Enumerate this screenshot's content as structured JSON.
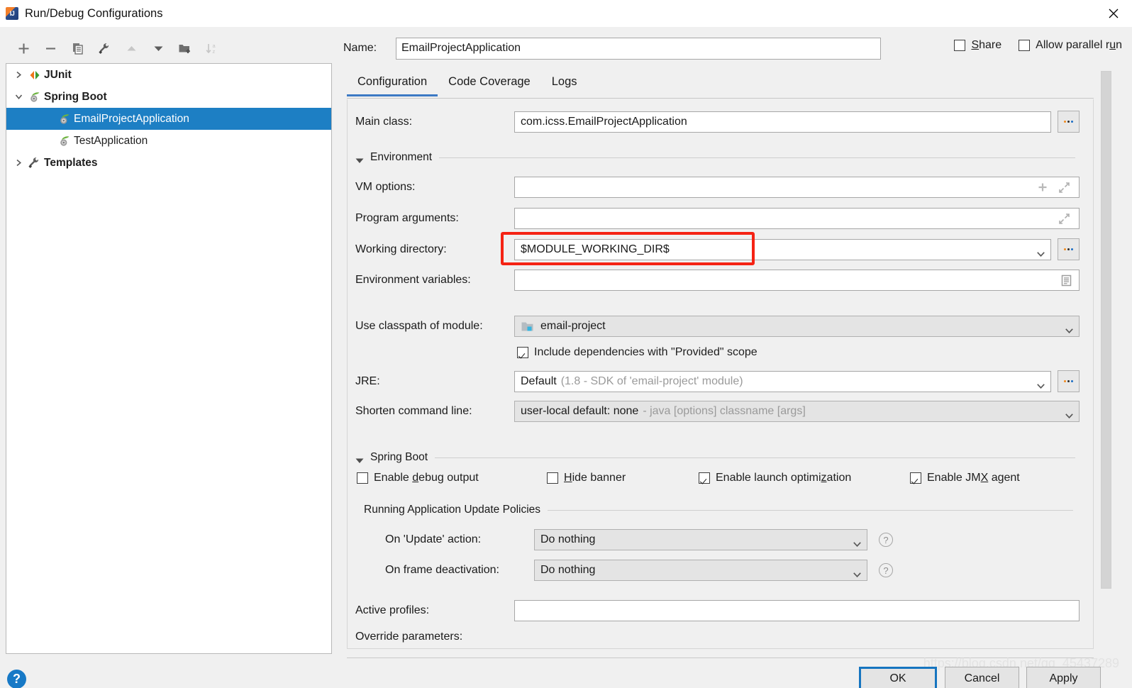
{
  "window": {
    "title": "Run/Debug Configurations",
    "app_icon": "intellij-idea-icon",
    "close_icon": "close-icon"
  },
  "left_toolbar": {
    "buttons": [
      {
        "name": "add-configuration-button",
        "icon": "plus-icon",
        "enabled": true
      },
      {
        "name": "remove-configuration-button",
        "icon": "minus-icon",
        "enabled": true
      },
      {
        "name": "copy-configuration-button",
        "icon": "copy-icon",
        "enabled": true
      },
      {
        "name": "edit-templates-button",
        "icon": "wrench-icon",
        "enabled": true
      },
      {
        "name": "move-up-button",
        "icon": "arrow-up-icon",
        "enabled": false
      },
      {
        "name": "move-down-button",
        "icon": "arrow-down-icon",
        "enabled": true
      },
      {
        "name": "new-folder-button",
        "icon": "folder-add-icon",
        "enabled": true
      },
      {
        "name": "sort-configurations-button",
        "icon": "sort-alphabetical-icon",
        "enabled": false
      }
    ]
  },
  "tree": {
    "items": [
      {
        "label": "JUnit",
        "icon": "junit-icon",
        "level": 0,
        "expanded": false,
        "has_toggle": true,
        "selected": false
      },
      {
        "label": "Spring Boot",
        "icon": "spring-boot-icon",
        "level": 0,
        "expanded": true,
        "has_toggle": true,
        "selected": false
      },
      {
        "label": "EmailProjectApplication",
        "icon": "spring-boot-icon",
        "level": 1,
        "has_toggle": false,
        "selected": true
      },
      {
        "label": "TestApplication",
        "icon": "spring-boot-icon",
        "level": 1,
        "has_toggle": false,
        "selected": false
      },
      {
        "label": "Templates",
        "icon": "wrench-icon",
        "level": 0,
        "expanded": false,
        "has_toggle": true,
        "selected": false
      }
    ]
  },
  "header": {
    "name_label": "Name:",
    "name_value": "EmailProjectApplication",
    "name_placeholder": "",
    "share": {
      "label": "Share",
      "mnemonic": "S",
      "checked": false
    },
    "allow_parallel_run": {
      "label": "Allow parallel run",
      "mnemonic": "u",
      "checked": false
    }
  },
  "tabs": [
    {
      "label": "Configuration",
      "active": true
    },
    {
      "label": "Code Coverage",
      "active": false
    },
    {
      "label": "Logs",
      "active": false
    }
  ],
  "configuration": {
    "main_class": {
      "label": "Main class:",
      "value": "com.icss.EmailProjectApplication",
      "browse_icon": "ellipsis-icon"
    },
    "environment_section": {
      "title": "Environment",
      "expanded": true,
      "toggle_icon": "triangle-down-icon"
    },
    "vm_options": {
      "label": "VM options:",
      "value": "",
      "placeholder": "",
      "icons": [
        "plus-icon",
        "expand-editor-icon"
      ]
    },
    "program_arguments": {
      "label": "Program arguments:",
      "value": "",
      "placeholder": "",
      "icons": [
        "expand-editor-icon"
      ]
    },
    "working_directory": {
      "label": "Working directory:",
      "value": "$MODULE_WORKING_DIR$",
      "placeholder": "",
      "dropdown_icon": "chevron-down-icon",
      "browse_icon": "ellipsis-icon",
      "highlighted": true,
      "highlight_color": "#f52314"
    },
    "environment_variables": {
      "label": "Environment variables:",
      "value": "",
      "placeholder": "",
      "icon": "list-edit-icon"
    },
    "use_classpath_of_module": {
      "label": "Use classpath of module:",
      "value": "email-project",
      "icon": "module-icon",
      "dropdown_icon": "chevron-down-icon"
    },
    "include_provided": {
      "label": "Include dependencies with \"Provided\" scope",
      "checked": true
    },
    "jre": {
      "label": "JRE:",
      "value": "Default",
      "value_hint": "(1.8 - SDK of 'email-project' module)",
      "dropdown_icon": "chevron-down-icon",
      "browse_icon": "ellipsis-icon"
    },
    "shorten_command_line": {
      "label": "Shorten command line:",
      "value": "user-local default: none",
      "value_hint": "- java [options] classname [args]",
      "dropdown_icon": "chevron-down-icon"
    },
    "spring_boot_section": {
      "title": "Spring Boot",
      "expanded": true,
      "toggle_icon": "triangle-down-icon"
    },
    "spring_boot_checkboxes": [
      {
        "label": "Enable debug output",
        "mnemonic": "d",
        "mnemonic_at": 7,
        "checked": false,
        "name": "enable-debug-output-checkbox"
      },
      {
        "label": "Hide banner",
        "mnemonic": "H",
        "mnemonic_at": 0,
        "checked": false,
        "name": "hide-banner-checkbox"
      },
      {
        "label": "Enable launch optimization",
        "mnemonic": "z",
        "mnemonic_at": 21,
        "checked": true,
        "name": "enable-launch-optimization-checkbox"
      },
      {
        "label": "Enable JMX agent",
        "mnemonic": "X",
        "mnemonic_at": 10,
        "checked": true,
        "name": "enable-jmx-agent-checkbox"
      }
    ],
    "update_policies": {
      "title": "Running Application Update Policies",
      "on_update_action": {
        "label": "On 'Update' action:",
        "value": "Do nothing",
        "dropdown_icon": "chevron-down-icon",
        "help_icon": "help-icon"
      },
      "on_frame_deactivation": {
        "label": "On frame deactivation:",
        "value": "Do nothing",
        "dropdown_icon": "chevron-down-icon",
        "help_icon": "help-icon"
      }
    },
    "active_profiles": {
      "label": "Active profiles:",
      "value": "",
      "placeholder": ""
    },
    "override_parameters": {
      "label": "Override parameters:"
    }
  },
  "footer": {
    "help_icon": "help-icon",
    "ok_label": "OK",
    "cancel_label": "Cancel",
    "apply_label": "Apply",
    "watermark": "https://blog.csdn.net/qq_45437289"
  },
  "colors": {
    "selection_blue": "#1d7fc4",
    "tab_accent": "#3c79c4",
    "annotation_red": "#f52314",
    "panel_bg": "#f0f0f0",
    "field_bg": "#ffffff",
    "disabled_field_bg": "#e4e4e4"
  }
}
